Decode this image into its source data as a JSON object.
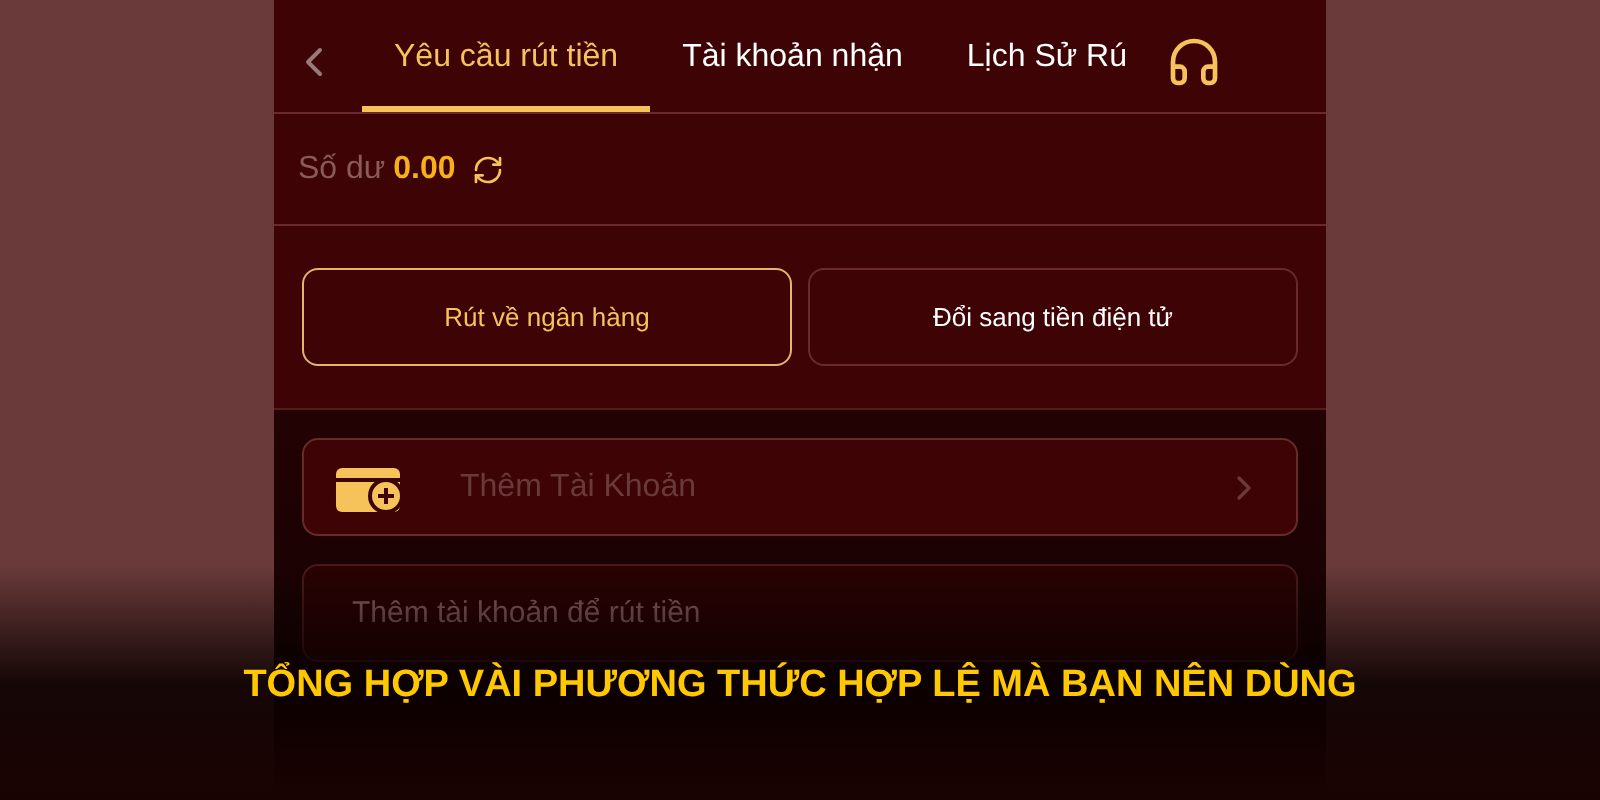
{
  "tabs": [
    {
      "label": "Yêu cầu rút tiền",
      "selected": true
    },
    {
      "label": "Tài khoản nhận",
      "selected": false
    },
    {
      "label": "Lịch Sử Rú",
      "selected": false
    }
  ],
  "balance": {
    "label": "Số dư",
    "amount": "0.00"
  },
  "methods": [
    {
      "label": "Rút về ngân hàng",
      "selected": true
    },
    {
      "label": "Đổi sang tiền điện tử",
      "selected": false
    }
  ],
  "add_account": {
    "label": "Thêm Tài Khoản"
  },
  "account_field": {
    "placeholder": "Thêm tài khoản để rút tiền"
  },
  "headline": "TỔNG HỢP VÀI PHƯƠNG THỨC HỢP LỆ MÀ BẠN NÊN DÙNG"
}
